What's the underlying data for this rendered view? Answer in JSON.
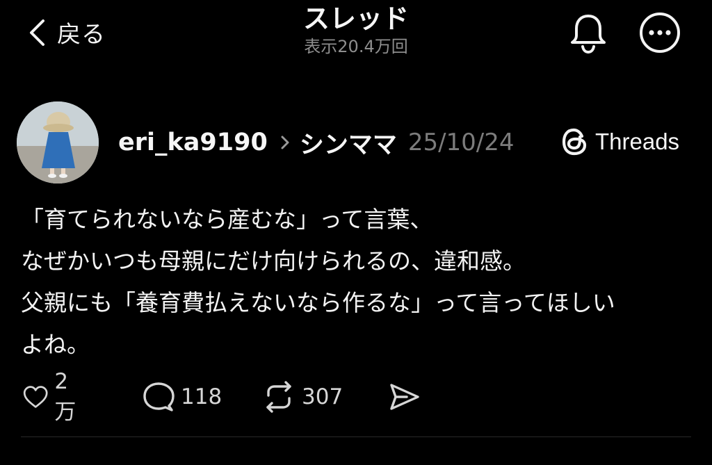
{
  "header": {
    "back_label": "戻る",
    "title": "スレッド",
    "views": "表示20.4万回"
  },
  "post": {
    "username": "eri_ka9190",
    "community": "シンママ",
    "date": "25/10/24",
    "source_badge": "Threads",
    "lines": [
      "「育てられないなら産むな」って言葉、",
      "なぜかいつも母親にだけ向けられるの、違和感。",
      "父親にも「養育費払えないなら作るな」って言ってほしい",
      "よね。"
    ]
  },
  "actions": {
    "likes": "2万",
    "replies": "118",
    "reposts": "307"
  },
  "icons": {
    "back": "chevron-left-icon",
    "bell": "bell-icon",
    "more": "more-options-icon",
    "threads": "threads-logo-icon",
    "like": "heart-icon",
    "reply": "comment-icon",
    "repost": "repost-icon",
    "share": "send-icon"
  },
  "colors": {
    "background": "#000000",
    "text": "#f3f3f3",
    "muted": "#8e8e8e",
    "date": "#7c7c7c",
    "divider": "#2a2a2a"
  }
}
